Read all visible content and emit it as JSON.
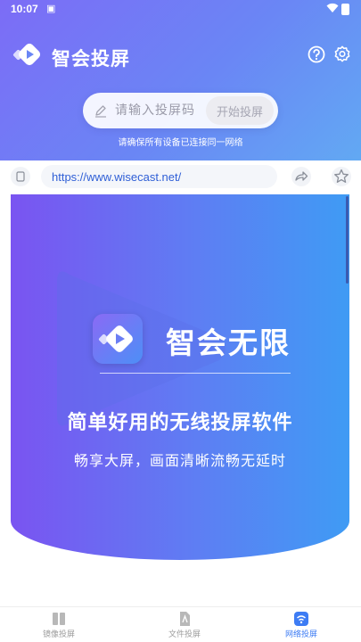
{
  "status_bar": {
    "time": "10:07",
    "sim_icon": "sim-card-icon",
    "wifi_icon": "wifi-icon",
    "battery_icon": "battery-icon"
  },
  "app": {
    "title": "智会投屏",
    "logo_icon": "logo-play-icon",
    "help_icon": "help-icon",
    "settings_icon": "gear-icon"
  },
  "cast_code": {
    "placeholder": "请输入投屏码",
    "value": "",
    "button_label": "开始投屏",
    "hint": "请确保所有设备已连接同一网络"
  },
  "browser": {
    "url": "https://www.wisecast.net/",
    "tabs_icon": "tabs-icon",
    "share_icon": "share-icon",
    "favorite_icon": "star-icon"
  },
  "banner": {
    "brand": "智会无限",
    "tagline": "简单好用的无线投屏软件",
    "subtagline": "畅享大屏，画面清晰流畅无延时"
  },
  "bottom_nav": [
    {
      "label": "镜像投屏",
      "icon": "mirror-icon",
      "active": false
    },
    {
      "label": "文件投屏",
      "icon": "file-icon",
      "active": false
    },
    {
      "label": "网络投屏",
      "icon": "network-icon",
      "active": true
    }
  ],
  "colors": {
    "accent": "#3d7cf4",
    "gradient_start": "#7c6cf6",
    "gradient_end": "#62a9f3"
  }
}
